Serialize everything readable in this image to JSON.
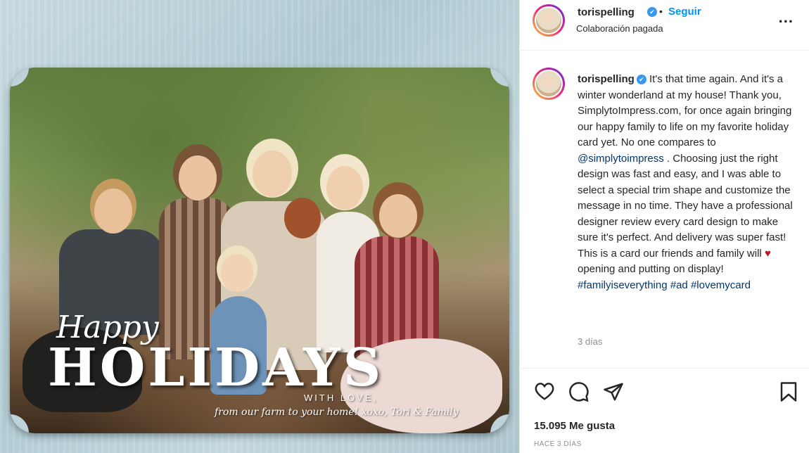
{
  "post_image": {
    "script_title": "Happy",
    "big_title": "HOLIDAYS",
    "with_love": "WITH LOVE,",
    "signoff": "from our farm to your home! xoxo, Tori & Family"
  },
  "header": {
    "username": "torispelling",
    "dot": "•",
    "follow_label": "Seguir",
    "paid_label": "Colaboración pagada",
    "more_label": "..."
  },
  "caption": {
    "username": "torispelling",
    "text_1": " It's that time again. And it's a winter wonderland at my house! Thank you, SimplytoImpress.com, for once again bringing our happy family to life on my favorite holiday card yet. No one compares to ",
    "mention": "@simplytoimpress",
    "text_2": " . Choosing just the right design was fast and easy, and I was able to select a special trim shape and customize the message in no time. They have a professional designer review every card design to make sure it's perfect. And delivery was super fast! This is a card our friends and family will ",
    "heart": "♥",
    "text_3": " opening and putting on display! ",
    "hashtag_1": "#familyiseverything",
    "hashtag_2": "#ad",
    "hashtag_3": "#lovemycard",
    "age": "3 días"
  },
  "actions": {
    "likes": "15.095 Me gusta",
    "posted_ago": "HACE 3 DÍAS"
  },
  "icons": [
    "heart-icon",
    "comment-icon",
    "share-icon",
    "bookmark-icon",
    "verified-icon",
    "more-icon"
  ],
  "colors": {
    "accent": "#0095f6",
    "link": "#00376b",
    "heart": "#c0171d",
    "muted": "#8e8e8e"
  }
}
